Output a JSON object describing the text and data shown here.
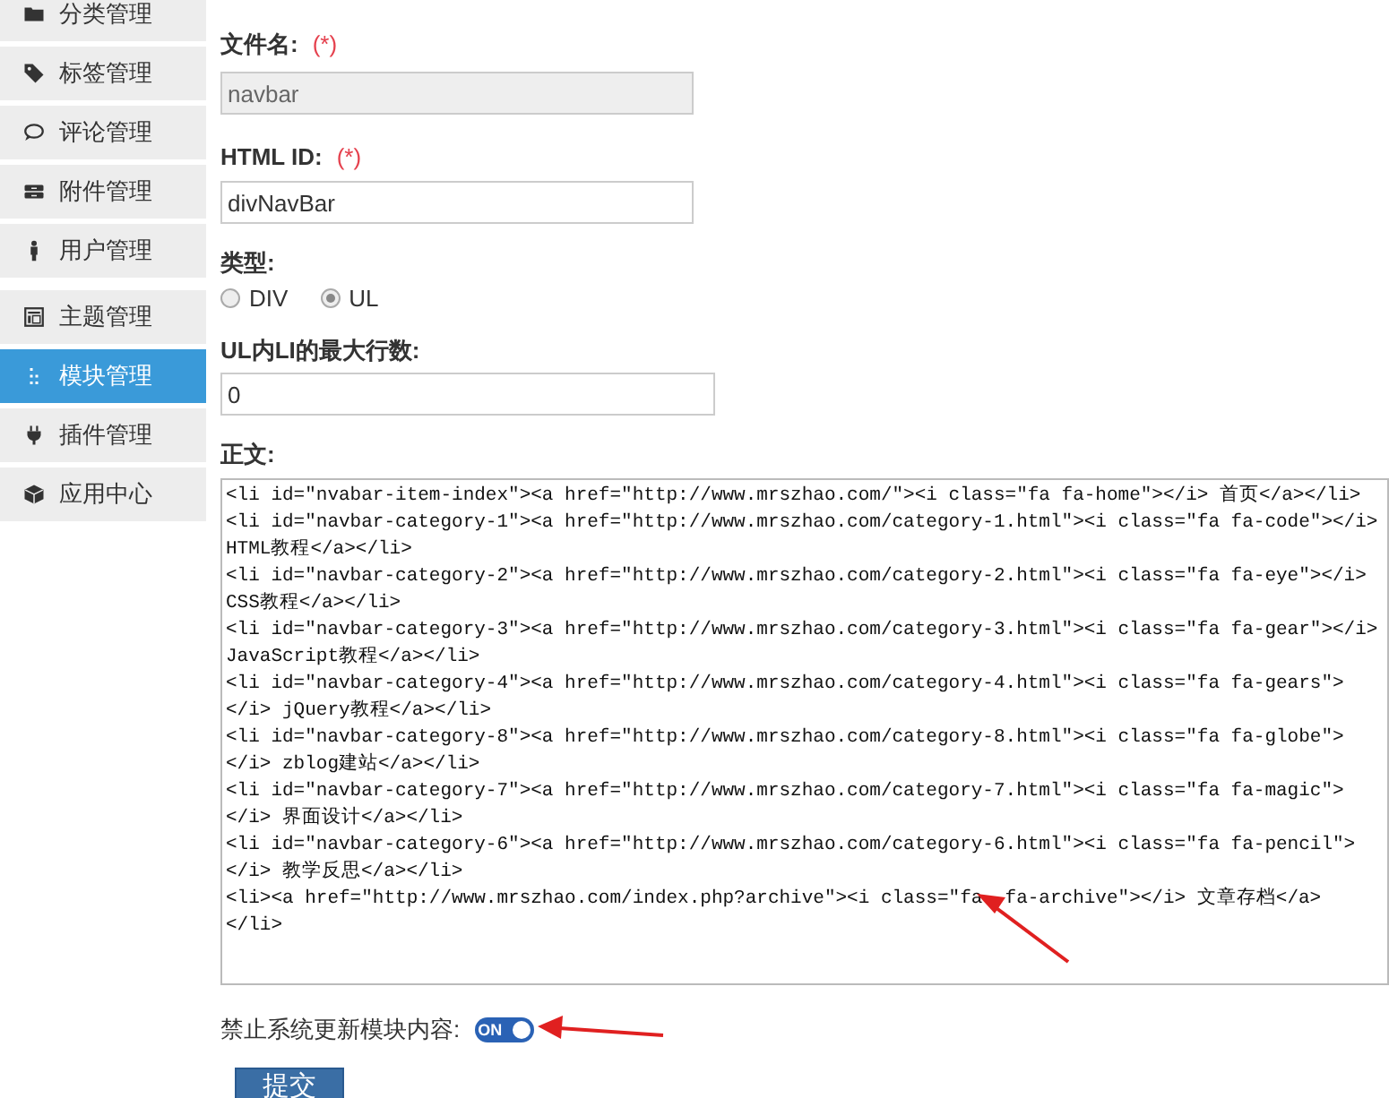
{
  "sidebar": {
    "items": [
      {
        "label": "分类管理",
        "selected": false
      },
      {
        "label": "标签管理",
        "selected": false
      },
      {
        "label": "评论管理",
        "selected": false
      },
      {
        "label": "附件管理",
        "selected": false
      },
      {
        "label": "用户管理",
        "selected": false
      },
      {
        "label": "主题管理",
        "selected": false
      },
      {
        "label": "模块管理",
        "selected": true
      },
      {
        "label": "插件管理",
        "selected": false
      },
      {
        "label": "应用中心",
        "selected": false
      }
    ]
  },
  "form": {
    "filename": {
      "label": "文件名:",
      "required": "(*)",
      "value": "navbar",
      "disabled": true
    },
    "html_id": {
      "label": "HTML ID:",
      "required": "(*)",
      "value": "divNavBar",
      "disabled": false
    },
    "type": {
      "label": "类型:",
      "options": [
        {
          "label": "DIV",
          "selected": false
        },
        {
          "label": "UL",
          "selected": true
        }
      ]
    },
    "max_rows": {
      "label": "UL内LI的最大行数:",
      "value": "0"
    },
    "body": {
      "label": "正文:",
      "lines": [
        "<li id=\"nvabar-item-index\"><a href=\"http://www.mrszhao.com/\"><i class=\"fa fa-home\"></i> 首页</a></li>",
        "<li id=\"navbar-category-1\"><a href=\"http://www.mrszhao.com/category-1.html\"><i class=\"fa fa-code\"></i>",
        "HTML教程</a></li>",
        "<li id=\"navbar-category-2\"><a href=\"http://www.mrszhao.com/category-2.html\"><i class=\"fa fa-eye\"></i>",
        "CSS教程</a></li>",
        "<li id=\"navbar-category-3\"><a href=\"http://www.mrszhao.com/category-3.html\"><i class=\"fa fa-gear\"></i>",
        "JavaScript教程</a></li>",
        "<li id=\"navbar-category-4\"><a href=\"http://www.mrszhao.com/category-4.html\"><i class=\"fa fa-gears\">",
        "</i> jQuery教程</a></li>",
        "<li id=\"navbar-category-8\"><a href=\"http://www.mrszhao.com/category-8.html\"><i class=\"fa fa-globe\">",
        "</i> zblog建站</a></li>",
        "<li id=\"navbar-category-7\"><a href=\"http://www.mrszhao.com/category-7.html\"><i class=\"fa fa-magic\">",
        "</i> 界面设计</a></li>",
        "<li id=\"navbar-category-6\"><a href=\"http://www.mrszhao.com/category-6.html\"><i class=\"fa fa-pencil\">",
        "</i> 教学反思</a></li>",
        "<li><a href=\"http://www.mrszhao.com/index.php?archive\"><i class=\"fa  fa-archive\"></i> 文章存档</a>",
        "</li>"
      ]
    },
    "lock": {
      "label": "禁止系统更新模块内容:",
      "toggle_text": "ON",
      "on": true
    },
    "submit": "提交"
  }
}
